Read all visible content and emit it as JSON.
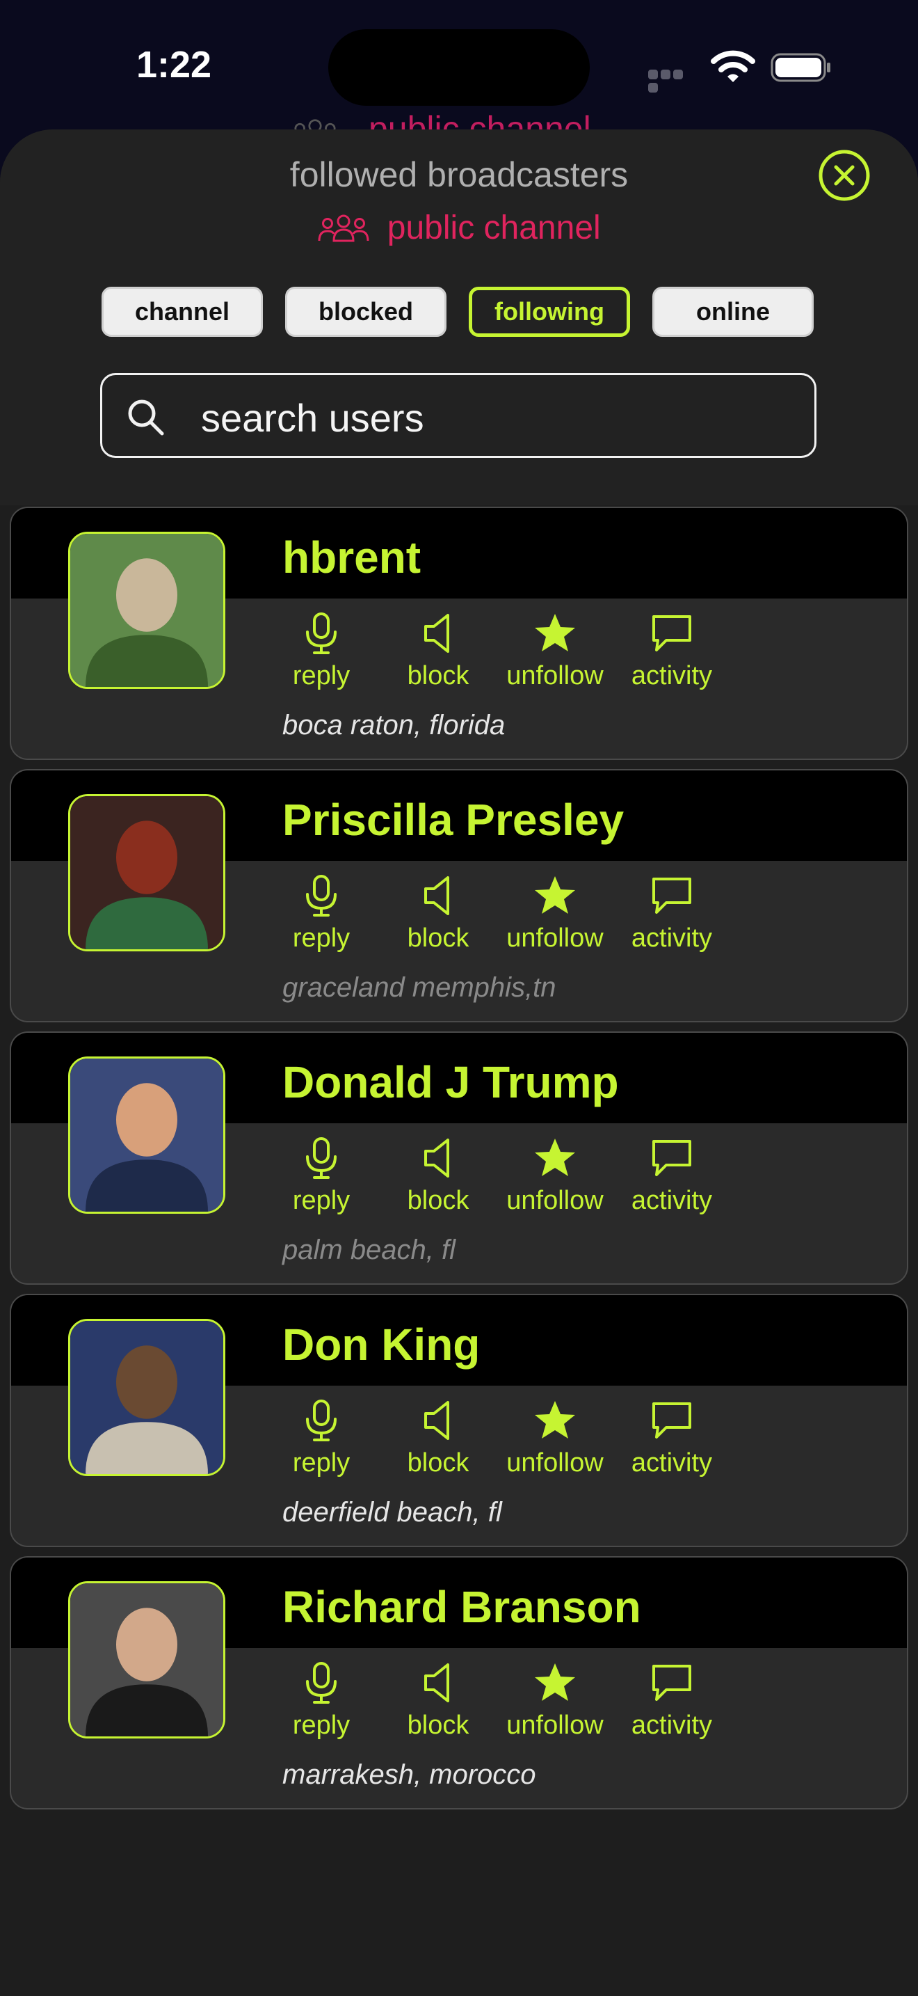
{
  "status_bar": {
    "time": "1:22",
    "icons": [
      "signal-dots-icon",
      "wifi-icon",
      "battery-icon"
    ]
  },
  "background_title": "public channel",
  "sheet": {
    "title": "followed broadcasters",
    "channel_icon": "people-group-icon",
    "channel_name": "public channel",
    "close_icon": "close-circle-icon"
  },
  "filters": [
    {
      "label": "channel",
      "active": false
    },
    {
      "label": "blocked",
      "active": false
    },
    {
      "label": "following",
      "active": true
    },
    {
      "label": "online",
      "active": false
    }
  ],
  "search": {
    "icon": "search-icon",
    "placeholder": "search users"
  },
  "actions": {
    "reply": {
      "label": "reply",
      "icon": "microphone-icon"
    },
    "block": {
      "label": "block",
      "icon": "speaker-icon"
    },
    "unfollow": {
      "label": "unfollow",
      "icon": "star-icon"
    },
    "activity": {
      "label": "activity",
      "icon": "speech-bubble-icon"
    }
  },
  "users": [
    {
      "name": "hbrent",
      "location": "boca raton, florida",
      "location_color": "#e6e6e6"
    },
    {
      "name": "Priscilla Presley",
      "location": "graceland memphis,tn",
      "location_color": "#8a8a8a"
    },
    {
      "name": "Donald J Trump",
      "location": "palm beach, fl",
      "location_color": "#8a8a8a"
    },
    {
      "name": "Don King",
      "location": "deerfield beach, fl",
      "location_color": "#e6e6e6"
    },
    {
      "name": "Richard Branson",
      "location": "marrakesh, morocco",
      "location_color": "#e6e6e6"
    }
  ],
  "colors": {
    "accent": "#c6f432",
    "channel_pink": "#e0245e",
    "sheet_bg": "#222222",
    "card_bg": "#2a2a2a",
    "name_band": "#000000"
  }
}
